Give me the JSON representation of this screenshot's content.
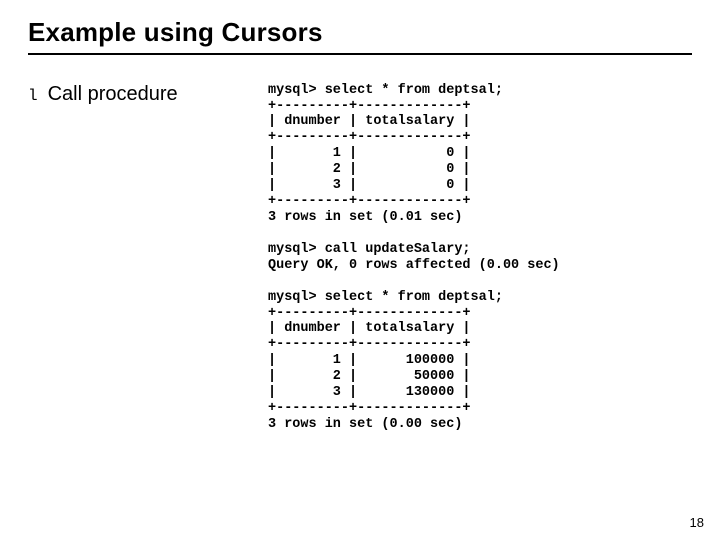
{
  "title": "Example using Cursors",
  "bullet": {
    "marker": "l",
    "text": "Call procedure"
  },
  "code": "mysql> select * from deptsal;\n+---------+-------------+\n| dnumber | totalsalary |\n+---------+-------------+\n|       1 |           0 |\n|       2 |           0 |\n|       3 |           0 |\n+---------+-------------+\n3 rows in set (0.01 sec)\n\nmysql> call updateSalary;\nQuery OK, 0 rows affected (0.00 sec)\n\nmysql> select * from deptsal;\n+---------+-------------+\n| dnumber | totalsalary |\n+---------+-------------+\n|       1 |      100000 |\n|       2 |       50000 |\n|       3 |      130000 |\n+---------+-------------+\n3 rows in set (0.00 sec)",
  "page_number": "18"
}
